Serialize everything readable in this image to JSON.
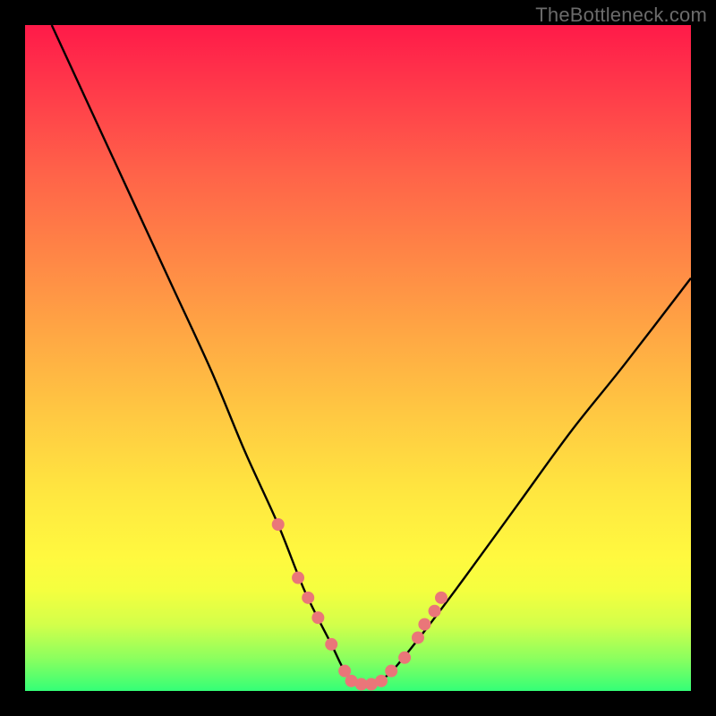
{
  "watermark": "TheBottleneck.com",
  "chart_data": {
    "type": "line",
    "title": "",
    "xlabel": "",
    "ylabel": "",
    "xlim": [
      0,
      100
    ],
    "ylim": [
      0,
      100
    ],
    "series": [
      {
        "name": "bottleneck-curve",
        "x": [
          4,
          10,
          16,
          22,
          28,
          33,
          38,
          42,
          46,
          48,
          50,
          52,
          54,
          56,
          60,
          66,
          74,
          82,
          90,
          100
        ],
        "values": [
          100,
          87,
          74,
          61,
          48,
          36,
          25,
          15,
          7,
          3,
          1,
          1,
          2,
          4,
          9,
          17,
          28,
          39,
          49,
          62
        ]
      }
    ],
    "dots": {
      "name": "highlighted-points",
      "x": [
        38,
        41,
        42.5,
        44,
        46,
        48,
        49,
        50.5,
        52,
        53.5,
        55,
        57,
        59,
        60,
        61.5,
        62.5
      ],
      "values": [
        25,
        17,
        14,
        11,
        7,
        3,
        1.5,
        1,
        1,
        1.5,
        3,
        5,
        8,
        10,
        12,
        14
      ]
    },
    "gradient_bands": [
      {
        "stop": 0,
        "color": "#ff1a49"
      },
      {
        "stop": 50,
        "color": "#ffb043"
      },
      {
        "stop": 80,
        "color": "#fff93f"
      },
      {
        "stop": 100,
        "color": "#34ff77"
      }
    ]
  }
}
